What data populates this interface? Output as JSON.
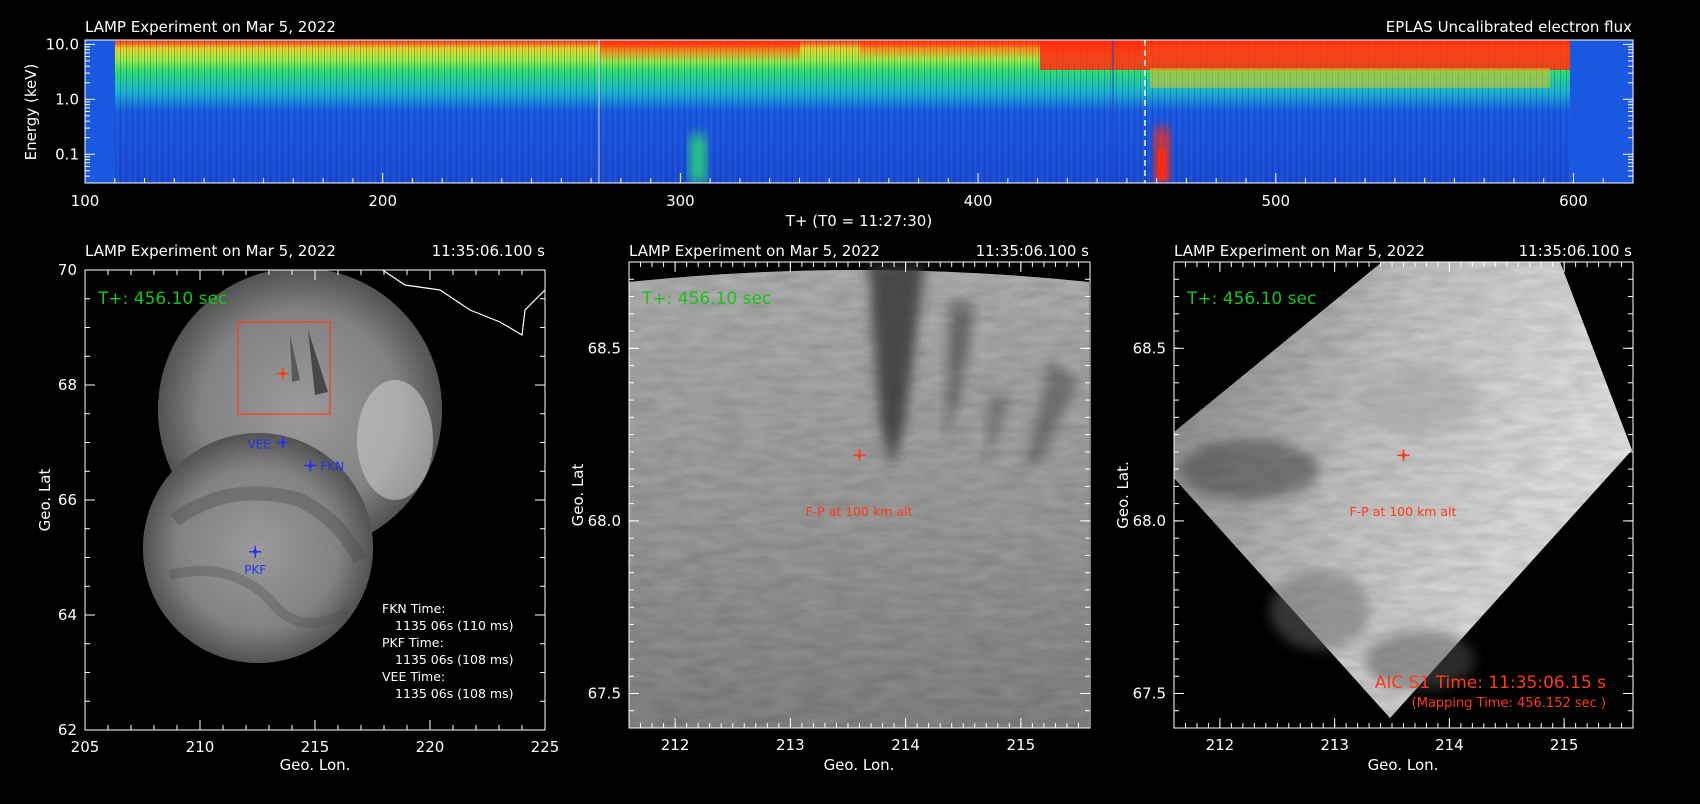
{
  "spectrogram": {
    "title_left": "LAMP Experiment on Mar 5, 2022",
    "title_right": "EPLAS Uncalibrated electron flux",
    "ylabel": "Energy (keV)",
    "xlabel": "T+ (T0 = 11:27:30)",
    "y_ticks": [
      "10.0",
      "1.0",
      "0.1"
    ],
    "x_ticks": [
      "100",
      "200",
      "300",
      "400",
      "500",
      "600"
    ]
  },
  "panels": [
    {
      "id": "mosaic",
      "title_left": "LAMP Experiment on Mar 5, 2022",
      "title_right": "11:35:06.100 s",
      "tplus": "T+: 456.10 sec",
      "xlabel": "Geo. Lon.",
      "ylabel": "Geo. Lat",
      "x_ticks": [
        "205",
        "210",
        "215",
        "220",
        "225"
      ],
      "y_ticks": [
        "70",
        "68",
        "66",
        "64",
        "62"
      ],
      "stations": [
        {
          "name": "VEE"
        },
        {
          "name": "FKN"
        },
        {
          "name": "PKF"
        }
      ],
      "times": [
        "FKN Time:",
        "1135 06s (110 ms)",
        "PKF Time:",
        "1135 06s (108 ms)",
        "VEE Time:",
        "1135 06s (108 ms)"
      ]
    },
    {
      "id": "zoom-camera",
      "title_left": "LAMP Experiment on Mar 5, 2022",
      "title_right": "11:35:06.100 s",
      "tplus": "T+: 456.10 sec",
      "xlabel": "Geo. Lon.",
      "ylabel": "Geo. Lat",
      "x_ticks": [
        "212",
        "213",
        "214",
        "215"
      ],
      "y_ticks": [
        "68.5",
        "68.0",
        "67.5"
      ],
      "footpoint_label": "F-P at 100 km alt"
    },
    {
      "id": "zoom-aic",
      "title_left": "LAMP Experiment on Mar 5, 2022",
      "title_right": "11:35:06.100 s",
      "tplus": "T+: 456.10 sec",
      "xlabel": "Geo. Lon.",
      "ylabel": "Geo. Lat.",
      "x_ticks": [
        "212",
        "213",
        "214",
        "215"
      ],
      "y_ticks": [
        "68.5",
        "68.0",
        "67.5"
      ],
      "footpoint_label": "F-P at 100 km alt",
      "aic_time": "AIC S1 Time: 11:35:06.15 s",
      "mapping_time": "(Mapping Time: 456.152 sec )"
    }
  ],
  "chart_data": [
    {
      "type": "heatmap",
      "title": "EPLAS Uncalibrated electron flux",
      "xlabel": "T+ (T0 = 11:27:30)",
      "ylabel": "Energy (keV)",
      "xlim": [
        100,
        620
      ],
      "ylim": [
        0.03,
        12
      ],
      "y_scale": "log",
      "colormap": "rainbow",
      "marker_time": 456.1
    },
    {
      "type": "scatter",
      "title": "LAMP Experiment on Mar 5, 2022",
      "xlabel": "Geo. Lon.",
      "ylabel": "Geo. Lat",
      "xlim": [
        205,
        225
      ],
      "ylim": [
        62,
        70
      ],
      "points": [
        {
          "label": "VEE",
          "x": 213.6,
          "y": 67.0
        },
        {
          "label": "FKN",
          "x": 214.8,
          "y": 66.6
        },
        {
          "label": "PKF",
          "x": 212.4,
          "y": 65.1
        },
        {
          "label": "footpoint",
          "x": 213.6,
          "y": 68.2
        }
      ]
    },
    {
      "type": "scatter",
      "title": "LAMP Experiment on Mar 5, 2022",
      "xlabel": "Geo. Lon.",
      "ylabel": "Geo. Lat",
      "xlim": [
        211.6,
        215.6
      ],
      "ylim": [
        67.4,
        68.75
      ],
      "points": [
        {
          "label": "F-P at 100 km alt",
          "x": 213.6,
          "y": 68.19
        }
      ]
    },
    {
      "type": "scatter",
      "title": "LAMP Experiment on Mar 5, 2022",
      "xlabel": "Geo. Lon.",
      "ylabel": "Geo. Lat.",
      "xlim": [
        211.6,
        215.6
      ],
      "ylim": [
        67.4,
        68.75
      ],
      "points": [
        {
          "label": "F-P at 100 km alt",
          "x": 213.6,
          "y": 68.19
        }
      ]
    }
  ],
  "colors": {
    "footpoint": "#ff3b16",
    "station": "#2233ee",
    "tplus": "#19c419",
    "aic_time": "#ff3b16"
  }
}
